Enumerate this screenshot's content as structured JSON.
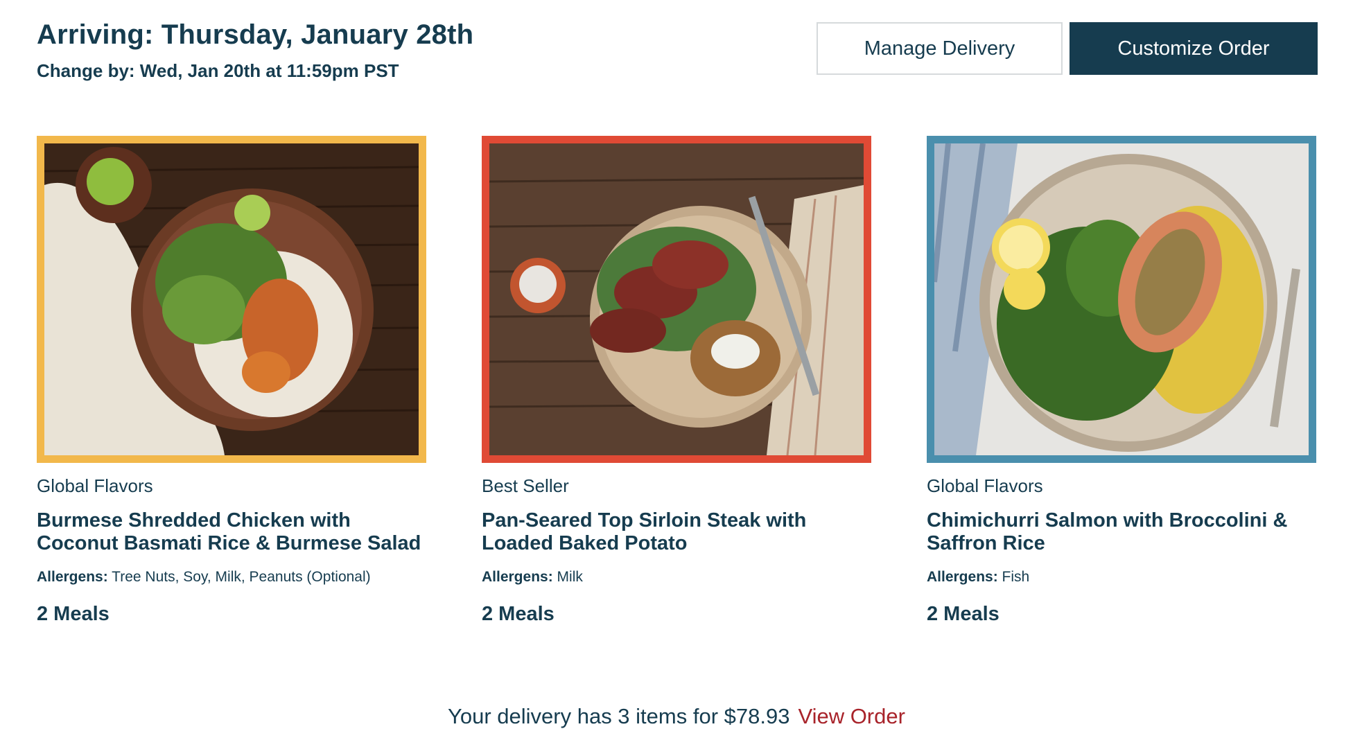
{
  "header": {
    "title": "Arriving: Thursday, January 28th",
    "subtitle": "Change by: Wed, Jan 20th at 11:59pm PST"
  },
  "buttons": {
    "manage": "Manage Delivery",
    "customize": "Customize Order"
  },
  "meals": [
    {
      "tag": "Global Flavors",
      "name_line1": "Burmese Shredded Chicken with",
      "name_line2": "Coconut Basmati Rice & Burmese Salad",
      "allergens_label": "Allergens:",
      "allergens": "Tree Nuts, Soy, Milk, Peanuts (Optional)",
      "quantity": "2 Meals",
      "frame_color": "#f2b84b"
    },
    {
      "tag": "Best Seller",
      "name_line1": "Pan-Seared Top Sirloin Steak with",
      "name_line2": "Loaded Baked Potato",
      "allergens_label": "Allergens:",
      "allergens": "Milk",
      "quantity": "2 Meals",
      "frame_color": "#e04a35"
    },
    {
      "tag": "Global Flavors",
      "name_line1": "Chimichurri Salmon with Broccolini &",
      "name_line2": "Saffron Rice",
      "allergens_label": "Allergens:",
      "allergens": "Fish",
      "quantity": "2 Meals",
      "frame_color": "#4a8fad"
    }
  ],
  "footer": {
    "summary": "Your delivery has 3 items for $78.93",
    "link": "View Order"
  },
  "colors": {
    "primary": "#163c4f",
    "link": "#a8232a"
  }
}
